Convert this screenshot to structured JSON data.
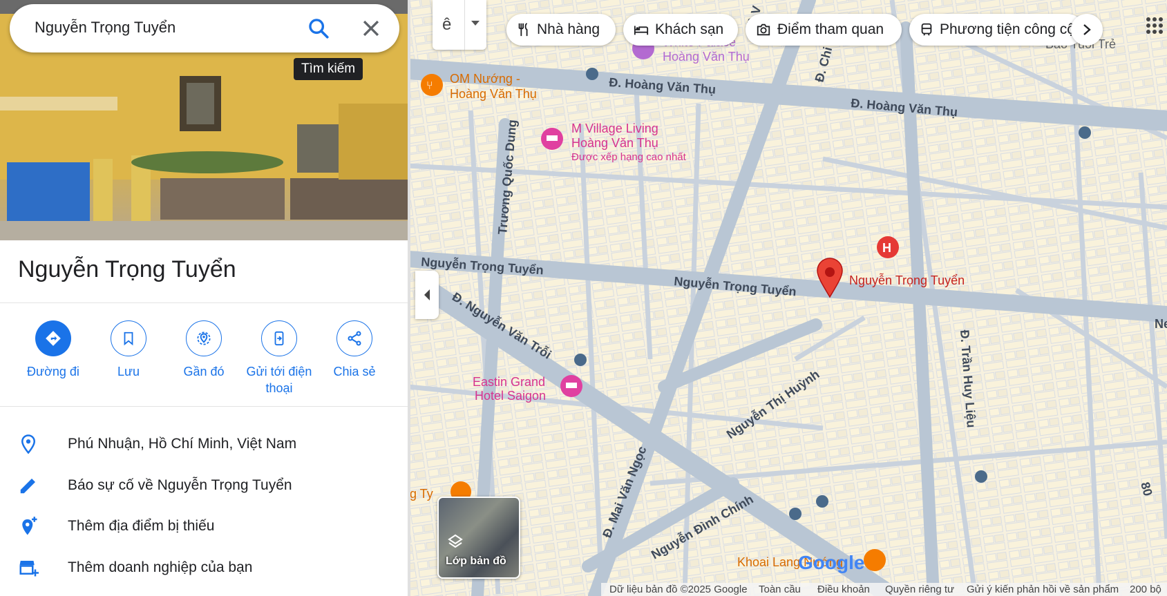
{
  "search": {
    "value": "Nguyễn Trọng Tuyển",
    "tooltip": "Tìm kiếm"
  },
  "place": {
    "title": "Nguyễn Trọng Tuyển"
  },
  "actions": [
    {
      "label": "Đường đi"
    },
    {
      "label": "Lưu"
    },
    {
      "label": "Gần đó"
    },
    {
      "label": "Gửi tới điện thoại"
    },
    {
      "label": "Chia sẻ"
    }
  ],
  "info": [
    {
      "text": "Phú Nhuận, Hồ Chí Minh, Việt Nam",
      "icon": "location-pin-icon"
    },
    {
      "text": "Báo sự cố về Nguyễn Trọng Tuyển",
      "icon": "pencil-icon"
    },
    {
      "text": "Thêm địa điểm bị thiếu",
      "icon": "add-location-icon"
    },
    {
      "text": "Thêm doanh nghiệp của bạn",
      "icon": "add-business-icon"
    }
  ],
  "chips": [
    {
      "label": "Nhà hàng",
      "icon": "restaurant-icon"
    },
    {
      "label": "Khách sạn",
      "icon": "hotel-icon"
    },
    {
      "label": "Điểm tham quan",
      "icon": "camera-icon"
    },
    {
      "label": "Phương tiện công cộng",
      "icon": "transit-icon"
    }
  ],
  "layer_switch": {
    "glyph": "ê"
  },
  "map": {
    "roads": {
      "hoang_van_thu_1": "Đ. Hoàng Văn Thụ",
      "hoang_van_thu_2": "Đ. Hoàng Văn Thụ",
      "truong_quoc_dung": "Trương Quốc Dung",
      "nguyen_trong_tuyen_1": "Nguyễn Trọng Tuyển",
      "nguyen_trong_tuyen_2": "Nguyễn Trọng Tuyển",
      "nguyen_van_troi": "Đ. Nguyễn Văn Trỗi",
      "nguyen_thi_huynh": "Nguyễn Thị Huỳnh",
      "tran_huy_lieu": "Đ. Trần Huy Liệu",
      "mai_van_ngoc": "Đ. Mai Văn Ngọc",
      "nguyen_dinh_chinh": "Nguyễn Đình Chính",
      "ho_van_hue": "Hồ V",
      "chi": "Đ. Chi",
      "partial_ne": "Ne",
      "num_80": "80"
    },
    "pois": {
      "om_nuong_1": "OM Nướng -",
      "om_nuong_2": "Hoàng Văn Thụ",
      "m_village_1": "M Village Living",
      "m_village_2": "Hoàng Văn Thụ",
      "m_village_rating": "Được xếp hạng cao nhất",
      "white_palace_1": "White Palace",
      "white_palace_2": "Hoàng Văn Thụ",
      "eastin_1": "Eastin Grand",
      "eastin_2": "Hotel Saigon",
      "khoai_lang": "Khoai Lang Nướng",
      "bao_tuoi_tre": "Báo Tuổi Trẻ",
      "g_ty": "g Ty",
      "pin_label": "Nguyễn Trọng Tuyển",
      "hospital": "H"
    },
    "logo": "Google"
  },
  "layers_button": {
    "label": "Lớp bản đồ"
  },
  "footer": {
    "data": "Dữ liệu bản đồ ©2025 Google",
    "global": "Toàn cầu",
    "terms": "Điều khoản",
    "privacy": "Quyền riêng tư",
    "feedback": "Gửi ý kiến phản hồi về sản phẩm",
    "scale": "200 bộ"
  },
  "colors": {
    "accent": "#1a73e8",
    "pin": "#ea4335",
    "hotel": "#e040a0",
    "restaurant": "#f57c00"
  }
}
